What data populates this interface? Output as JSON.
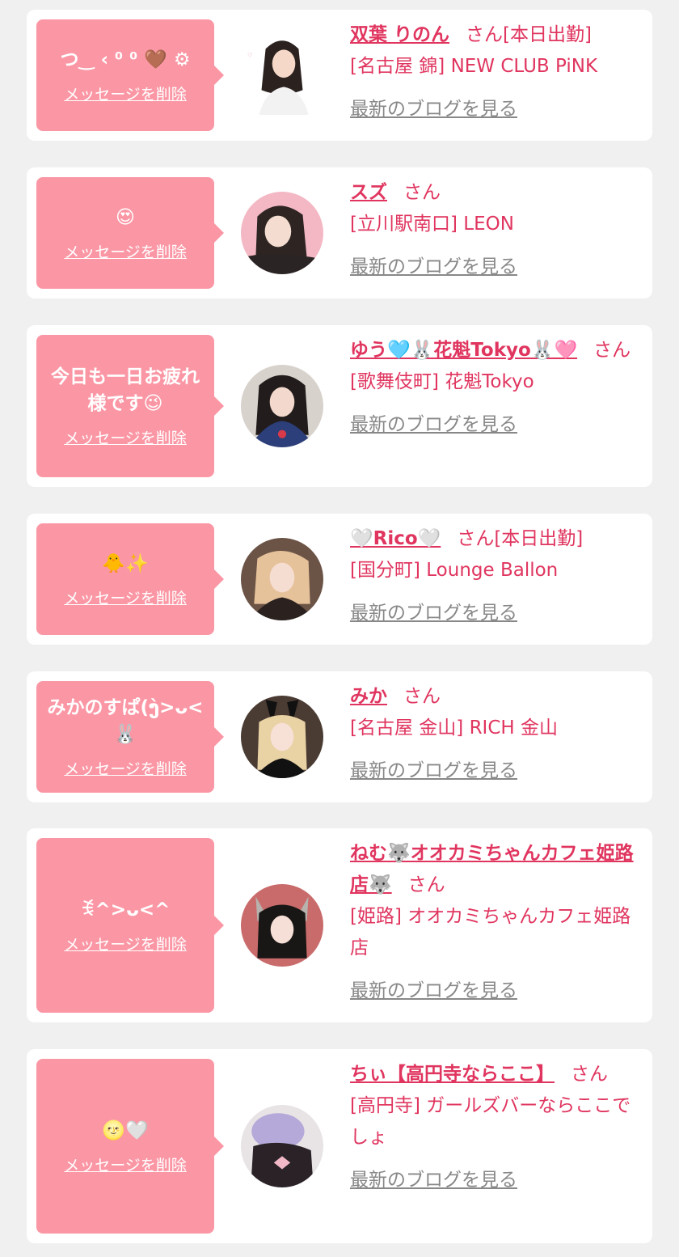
{
  "delete_label": "メッセージを削除",
  "blog_label": "最新のブログを見る",
  "san_label": "さん",
  "cards": [
    {
      "message": "つ‿ ‹ ⁰ ⁰ 🤎 ⚙",
      "name": "双葉 りのん",
      "san": "さん[本日出勤]",
      "shop": "[名古屋 錦] NEW CLUB PiNK"
    },
    {
      "message": "😍",
      "name": "スズ",
      "san": "さん",
      "shop": "[立川駅南口] LEON"
    },
    {
      "message": "今日も一日お疲れ様です😉",
      "name": "ゆう🩵🐰花魁Tokyo🐰🩷",
      "san": "さん",
      "shop": "[歌舞伎町] 花魁Tokyo"
    },
    {
      "message": "🐥✨",
      "name": "🤍Rico🤍",
      "san": "さん[本日出勤]",
      "shop": "[国分町] Lounge Ballon"
    },
    {
      "message": "みかのすぱ(ງ̀>ᴗ<🐰",
      "name": "みか",
      "san": "さん",
      "shop": "[名古屋 金山] RICH 金山"
    },
    {
      "message": "ꉂ^>ᴗ<^",
      "name": "ねむ🐺オオカミちゃんカフェ姫路店🐺",
      "san": "さん",
      "shop": "[姫路] オオカミちゃんカフェ姫路店"
    },
    {
      "message": "🌝🤍",
      "name": "ちぃ【高円寺ならここ】",
      "san": "さん",
      "shop": "[高円寺] ガールズバーならここでしょ"
    }
  ],
  "colors": {
    "bubble": "#fb97a5",
    "accent": "#e0355f",
    "link_gray": "#888888",
    "background": "#f0f0f0"
  }
}
